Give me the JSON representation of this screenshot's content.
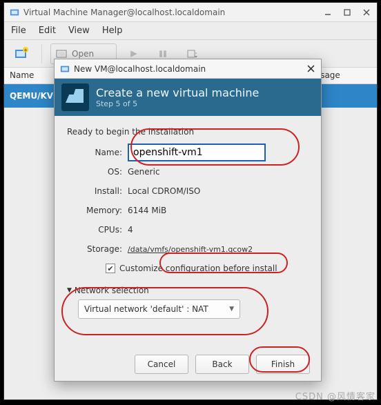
{
  "main": {
    "title": "Virtual Machine Manager@localhost.localdomain",
    "menu": {
      "file": "File",
      "edit": "Edit",
      "view": "View",
      "help": "Help"
    },
    "toolbar": {
      "open": "Open"
    },
    "columns": {
      "name": "Name",
      "cpu": "U usage"
    },
    "row_selected": "QEMU/KV"
  },
  "dialog": {
    "title": "New VM@localhost.localdomain",
    "header": {
      "title": "Create a new virtual machine",
      "step": "Step 5 of 5"
    },
    "ready": "Ready to begin the installation",
    "labels": {
      "name": "Name:",
      "os": "OS:",
      "install": "Install:",
      "memory": "Memory:",
      "cpus": "CPUs:",
      "storage": "Storage:"
    },
    "values": {
      "name": "openshift-vm1",
      "os": "Generic",
      "install": "Local CDROM/ISO",
      "memory": "6144 MiB",
      "cpus": "4",
      "storage": "/data/vmfs/openshift-vm1.qcow2"
    },
    "customize": "Customize configuration before install",
    "network": {
      "title": "Network selection",
      "value": "Virtual network 'default' : NAT"
    },
    "buttons": {
      "cancel": "Cancel",
      "back": "Back",
      "finish": "Finish"
    }
  },
  "watermark": "CSDN @风情客家"
}
